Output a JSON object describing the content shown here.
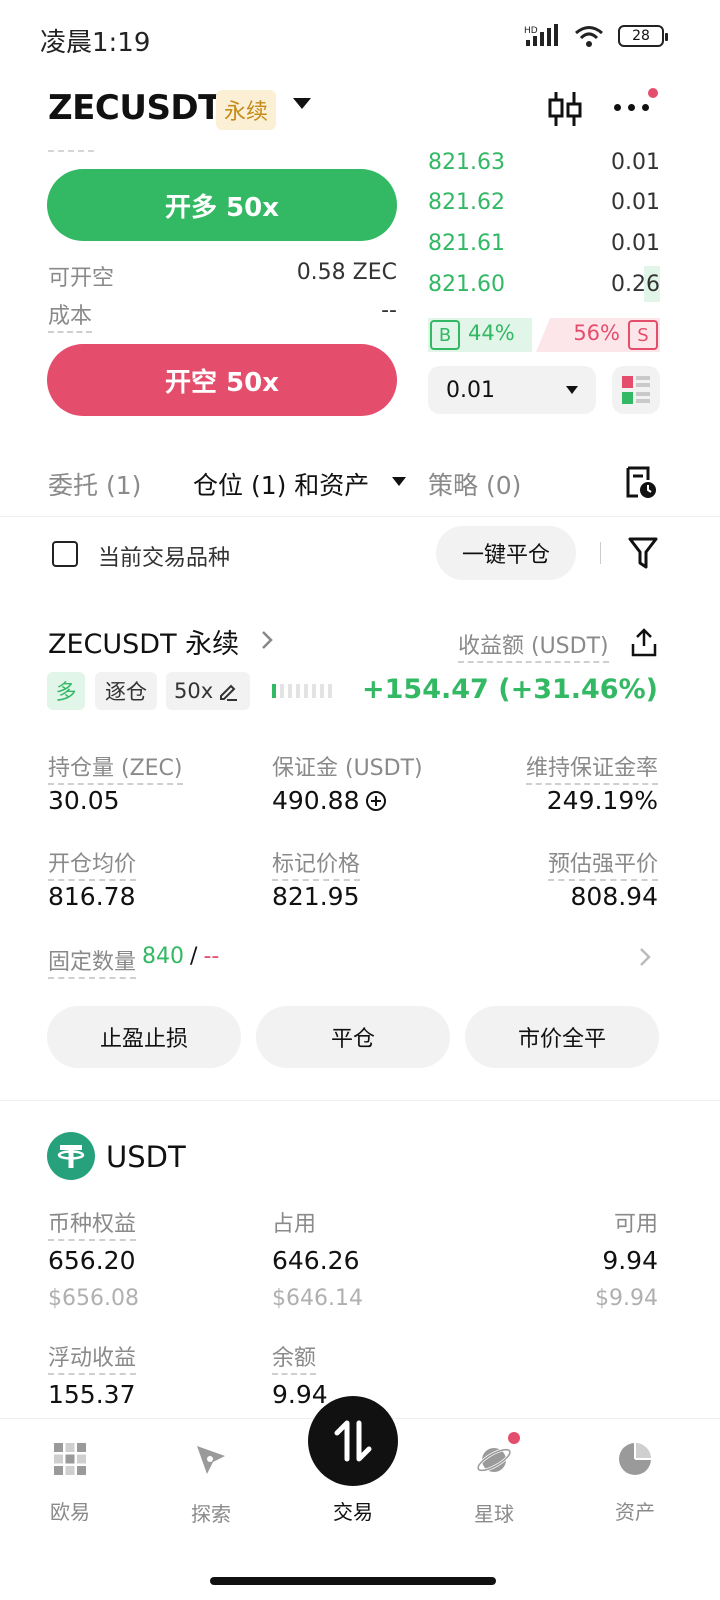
{
  "status_bar": {
    "time": "凌晨1:19",
    "network": "HD",
    "battery": "28"
  },
  "header": {
    "pair": "ZECUSDT",
    "badge": "永续"
  },
  "order_book": {
    "rows": [
      {
        "price": "821.63",
        "qty": "0.01"
      },
      {
        "price": "821.62",
        "qty": "0.01"
      },
      {
        "price": "821.61",
        "qty": "0.01"
      },
      {
        "price": "821.60",
        "qty": "0.26"
      }
    ],
    "buy_label": "B",
    "buy_pct": "44%",
    "sell_pct": "56%",
    "sell_label": "S",
    "precision": "0.01"
  },
  "order_form": {
    "long_button": "开多 50x",
    "short_button": "开空 50x",
    "available_label": "可开空",
    "available_value": "0.58 ZEC",
    "cost_label": "成本",
    "cost_value": "--"
  },
  "tabs": {
    "orders": "委托 (1)",
    "positions": "仓位 (1) 和资产",
    "strategies": "策略 (0)"
  },
  "filter": {
    "current_pair_label": "当前交易品种",
    "close_all_button": "一键平仓"
  },
  "position": {
    "title": "ZECUSDT 永续",
    "pnl_label": "收益额 (USDT)",
    "side": "多",
    "margin_mode": "逐仓",
    "leverage": "50x",
    "pnl_value": "+154.47 (+31.46%)",
    "stats": [
      {
        "label": "持仓量 (ZEC)",
        "value": "30.05"
      },
      {
        "label": "保证金 (USDT)",
        "value": "490.88"
      },
      {
        "label": "维持保证金率",
        "value": "249.19%"
      },
      {
        "label": "开仓均价",
        "value": "816.78"
      },
      {
        "label": "标记价格",
        "value": "821.95"
      },
      {
        "label": "预估强平价",
        "value": "808.94"
      }
    ],
    "fixed_qty_label": "固定数量",
    "fixed_qty_value": "840",
    "fixed_qty_sep": "/",
    "fixed_qty_alt": "--",
    "buttons": {
      "tpsl": "止盈止损",
      "close": "平仓",
      "market_close": "市价全平"
    }
  },
  "asset": {
    "name": "USDT",
    "equity_label": "币种权益",
    "equity_value": "656.20",
    "equity_usd": "$656.08",
    "occupied_label": "占用",
    "occupied_value": "646.26",
    "occupied_usd": "$646.14",
    "available_label": "可用",
    "available_value": "9.94",
    "available_usd": "$9.94",
    "floating_label": "浮动收益",
    "floating_value": "155.37",
    "balance_label": "余额",
    "balance_value": "9.94"
  },
  "nav": {
    "home": "欧易",
    "discover": "探索",
    "trade": "交易",
    "planet": "星球",
    "assets": "资产"
  }
}
